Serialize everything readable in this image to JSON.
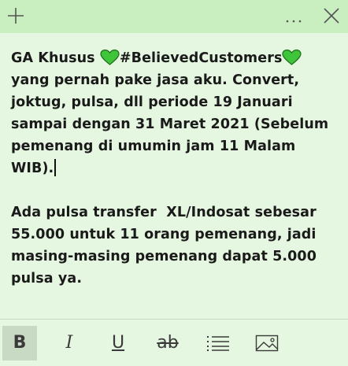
{
  "titlebar": {
    "new_icon": "plus-icon",
    "menu_icon": "ellipsis-icon",
    "close_icon": "close-icon"
  },
  "note": {
    "heart_color": "#3ec53a",
    "lines": [
      {
        "segments": [
          "GA Khusus ",
          "heart",
          "#BelievedCustomers",
          "heart"
        ]
      },
      {
        "segments": [
          "yang pernah pake jasa aku. Convert,"
        ]
      },
      {
        "segments": [
          "joktug, pulsa, dll periode 19 Januari"
        ]
      },
      {
        "segments": [
          "sampai dengan 31 Maret 2021 (Sebelum"
        ]
      },
      {
        "segments": [
          "pemenang di umumin jam 11 Malam"
        ]
      },
      {
        "segments": [
          "WIB)."
        ]
      },
      {
        "segments": [
          ""
        ]
      },
      {
        "segments": [
          "Ada pulsa transfer  XL/Indosat sebesar"
        ]
      },
      {
        "segments": [
          "55.000 untuk 11 orang pemenang, jadi"
        ]
      },
      {
        "segments": [
          "masing-masing pemenang dapat 5.000"
        ]
      },
      {
        "segments": [
          "pulsa ya."
        ]
      }
    ]
  },
  "toolbar": {
    "bold_label": "B",
    "italic_label": "I",
    "underline_label": "U",
    "strike_label": "ab",
    "bold_active": true,
    "list_icon": "bulleted-list-icon",
    "image_icon": "image-icon"
  },
  "colors": {
    "background": "#e5f7e0",
    "titlebar": "#c9efc0",
    "active_tool": "#c8d9c4"
  }
}
